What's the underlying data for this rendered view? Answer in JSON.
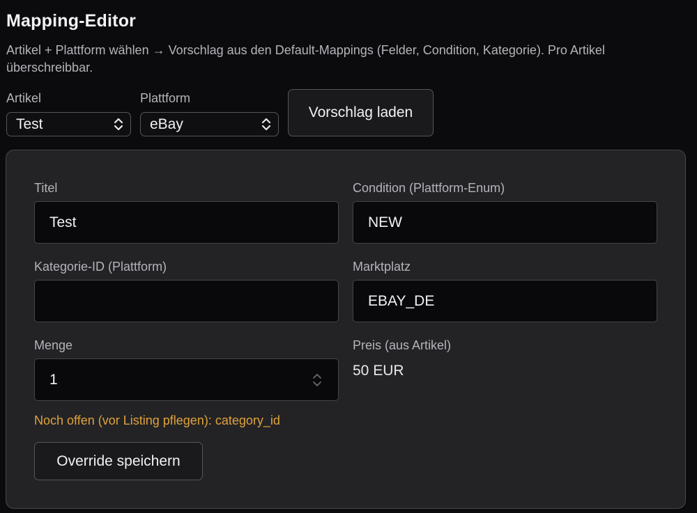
{
  "header": {
    "title": "Mapping-Editor",
    "description": "Artikel + Plattform wählen → Vorschlag aus den Default-Mappings (Felder, Condition, Kategorie). Pro Artikel überschreibbar."
  },
  "controls": {
    "article_label": "Artikel",
    "article_value": "Test",
    "platform_label": "Plattform",
    "platform_value": "eBay",
    "load_button": "Vorschlag laden"
  },
  "form": {
    "title_label": "Titel",
    "title_value": "Test",
    "condition_label": "Condition (Plattform-Enum)",
    "condition_value": "NEW",
    "category_label": "Kategorie-ID (Plattform)",
    "category_value": "",
    "marketplace_label": "Marktplatz",
    "marketplace_value": "EBAY_DE",
    "quantity_label": "Menge",
    "quantity_value": "1",
    "price_label": "Preis (aus Artikel)",
    "price_value": "50 EUR",
    "warning": "Noch offen (vor Listing pflegen): category_id",
    "save_button": "Override speichern"
  },
  "icons": {
    "select_chevron": "chevron-up-down-icon",
    "number_stepper": "stepper-icon"
  },
  "colors": {
    "background": "#0b0b0d",
    "panel": "#232326",
    "warning": "#e0a23a"
  }
}
